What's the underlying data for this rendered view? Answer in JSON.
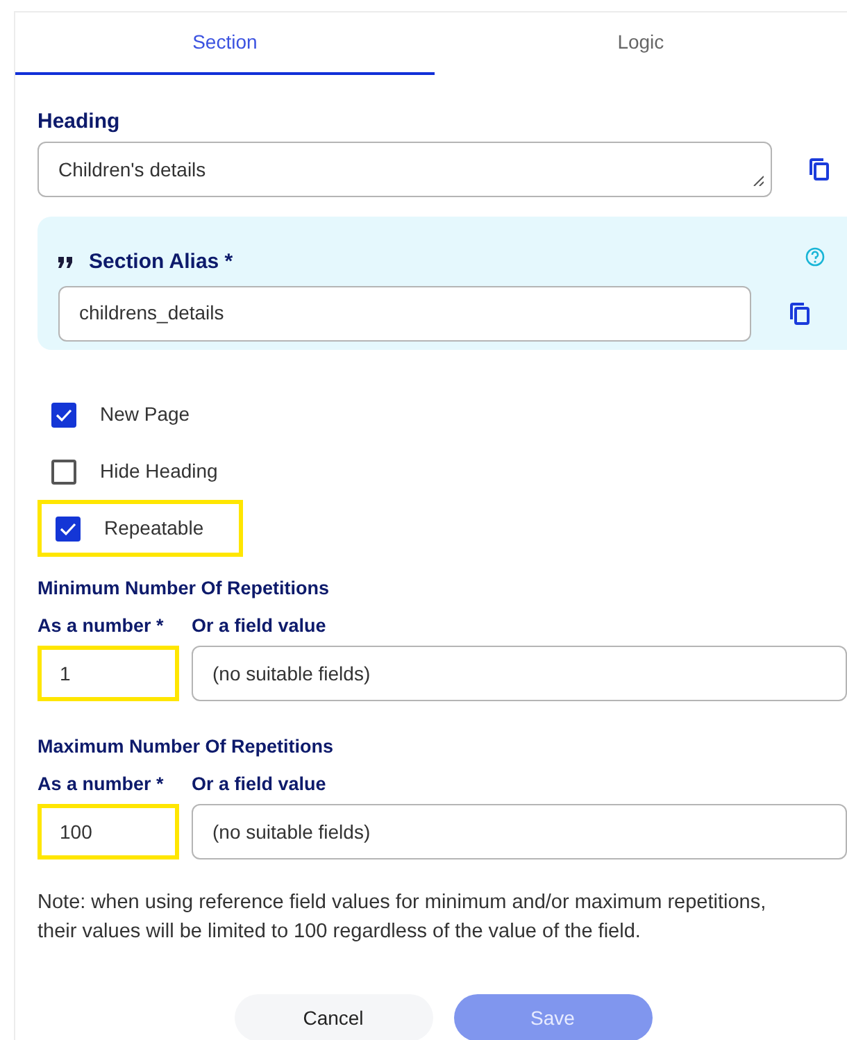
{
  "tabs": [
    {
      "label": "Section",
      "selected": true
    },
    {
      "label": "Logic",
      "selected": false
    }
  ],
  "heading": {
    "label": "Heading",
    "value": "Children's details"
  },
  "section_alias": {
    "label": "Section Alias *",
    "value": "childrens_details"
  },
  "options": [
    {
      "label": "New Page",
      "checked": true,
      "highlighted": false
    },
    {
      "label": "Hide Heading",
      "checked": false,
      "highlighted": false
    },
    {
      "label": "Repeatable",
      "checked": true,
      "highlighted": true
    }
  ],
  "repetitions": [
    {
      "title": "Minimum Number Of Repetitions",
      "number_label": "As a number *",
      "field_label": "Or a field value",
      "number": "1",
      "field_value": "(no suitable fields)",
      "highlighted": true
    },
    {
      "title": "Maximum Number Of Repetitions",
      "number_label": "As a number *",
      "field_label": "Or a field value",
      "number": "100",
      "field_value": "(no suitable fields)",
      "highlighted": true
    }
  ],
  "note": "Note: when using reference field values for minimum and/or maximum repetitions, their values will be limited to 100 regardless of the value of the field.",
  "buttons": [
    {
      "label": "Cancel",
      "kind": "secondary",
      "disabled": false
    },
    {
      "label": "Save",
      "kind": "primary",
      "disabled": true
    }
  ]
}
